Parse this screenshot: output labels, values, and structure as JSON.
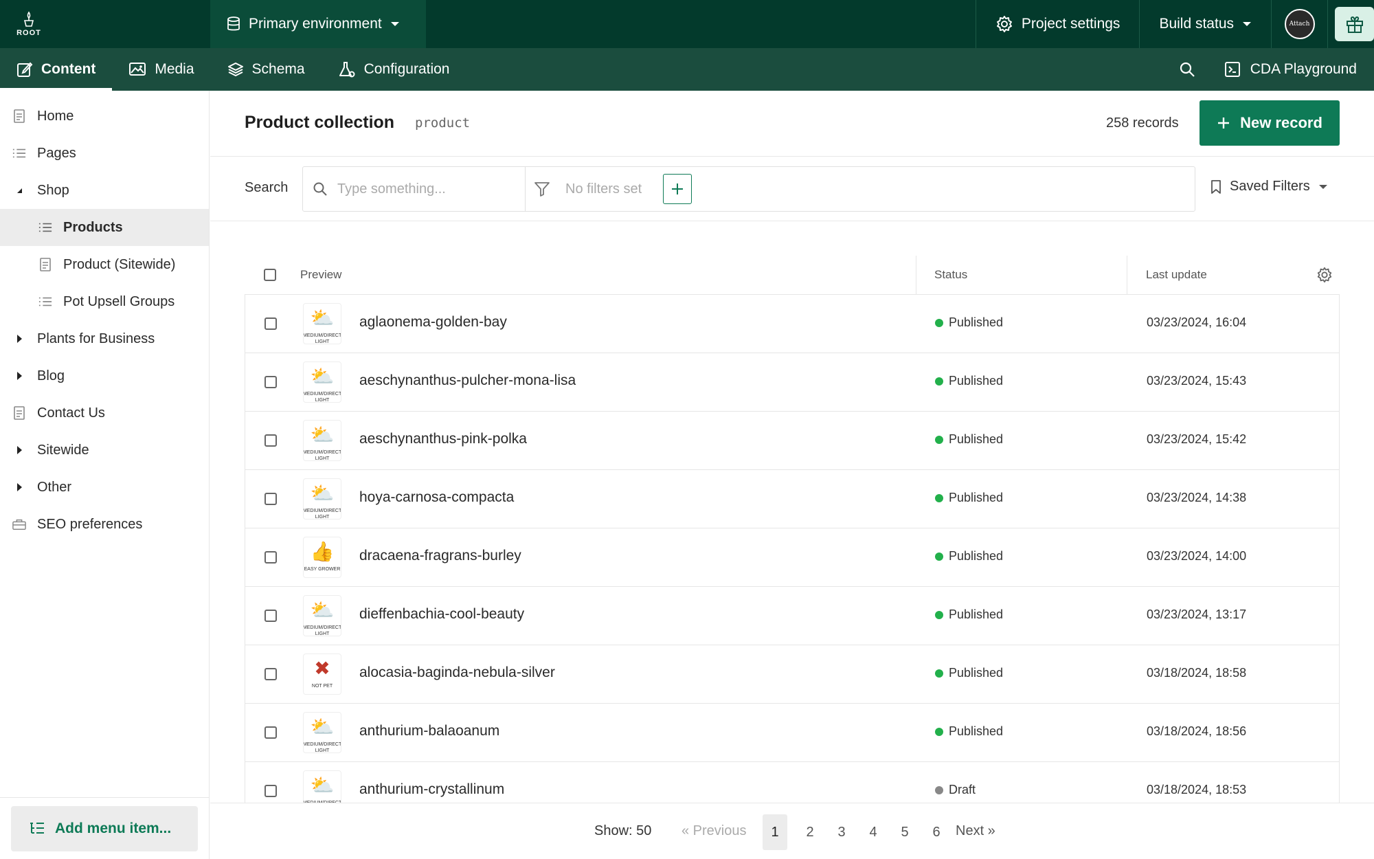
{
  "brand": {
    "logo_text": "ROOT"
  },
  "topbar": {
    "environment": "Primary environment",
    "project_settings": "Project settings",
    "build_status": "Build status",
    "avatar_text": "Attach"
  },
  "nav": {
    "tabs": [
      {
        "label": "Content",
        "icon": "edit-icon"
      },
      {
        "label": "Media",
        "icon": "image-icon"
      },
      {
        "label": "Schema",
        "icon": "layers-icon"
      },
      {
        "label": "Configuration",
        "icon": "flask-icon"
      }
    ],
    "active_tab": "Content",
    "playground": "CDA Playground"
  },
  "sidebar": {
    "items": [
      {
        "label": "Home",
        "icon": "document-icon"
      },
      {
        "label": "Pages",
        "icon": "list-icon"
      },
      {
        "label": "Shop",
        "icon": "caret-down-icon"
      },
      {
        "label": "Products",
        "icon": "list-icon"
      },
      {
        "label": "Product (Sitewide)",
        "icon": "document-icon"
      },
      {
        "label": "Pot Upsell Groups",
        "icon": "list-icon"
      },
      {
        "label": "Plants for Business",
        "icon": "caret-right-icon"
      },
      {
        "label": "Blog",
        "icon": "caret-right-icon"
      },
      {
        "label": "Contact Us",
        "icon": "document-icon"
      },
      {
        "label": "Sitewide",
        "icon": "caret-right-icon"
      },
      {
        "label": "Other",
        "icon": "caret-right-icon"
      },
      {
        "label": "SEO preferences",
        "icon": "toolbox-icon"
      }
    ],
    "add_menu_item": "Add menu item..."
  },
  "main": {
    "title": "Product collection",
    "api_key": "product",
    "record_count": "258 records",
    "new_record": "New record",
    "search": {
      "label": "Search",
      "placeholder": "Type something...",
      "filters": "No filters set",
      "saved_filters": "Saved Filters"
    },
    "table": {
      "columns": [
        "Preview",
        "Status",
        "Last update"
      ],
      "rows": [
        {
          "slug": "aglaonema-golden-bay",
          "status": "Published",
          "updated": "03/23/2024, 16:04",
          "thumb": "MEDIUM/DIRECT LIGHT"
        },
        {
          "slug": "aeschynanthus-pulcher-mona-lisa",
          "status": "Published",
          "updated": "03/23/2024, 15:43",
          "thumb": "MEDIUM/DIRECT LIGHT"
        },
        {
          "slug": "aeschynanthus-pink-polka",
          "status": "Published",
          "updated": "03/23/2024, 15:42",
          "thumb": "MEDIUM/DIRECT LIGHT"
        },
        {
          "slug": "hoya-carnosa-compacta",
          "status": "Published",
          "updated": "03/23/2024, 14:38",
          "thumb": "MEDIUM/DIRECT LIGHT"
        },
        {
          "slug": "dracaena-fragrans-burley",
          "status": "Published",
          "updated": "03/23/2024, 14:00",
          "thumb": "EASY GROWER"
        },
        {
          "slug": "dieffenbachia-cool-beauty",
          "status": "Published",
          "updated": "03/23/2024, 13:17",
          "thumb": "MEDIUM/DIRECT LIGHT"
        },
        {
          "slug": "alocasia-baginda-nebula-silver",
          "status": "Published",
          "updated": "03/18/2024, 18:58",
          "thumb": "NOT PET"
        },
        {
          "slug": "anthurium-balaoanum",
          "status": "Published",
          "updated": "03/18/2024, 18:56",
          "thumb": "MEDIUM/DIRECT LIGHT"
        },
        {
          "slug": "anthurium-crystallinum",
          "status": "Draft",
          "updated": "03/18/2024, 18:53",
          "thumb": "MEDIUM/DIRECT LIGHT"
        }
      ]
    },
    "pagination": {
      "show": "Show: 50",
      "previous": "« Previous",
      "pages": [
        "1",
        "2",
        "3",
        "4",
        "5",
        "6"
      ],
      "current": "1",
      "next": "Next »"
    }
  },
  "colors": {
    "topbar": "#033a2c",
    "navbar": "#1b4d3e",
    "accent": "#0e7a56",
    "published": "#22b04b",
    "draft": "#888888"
  }
}
